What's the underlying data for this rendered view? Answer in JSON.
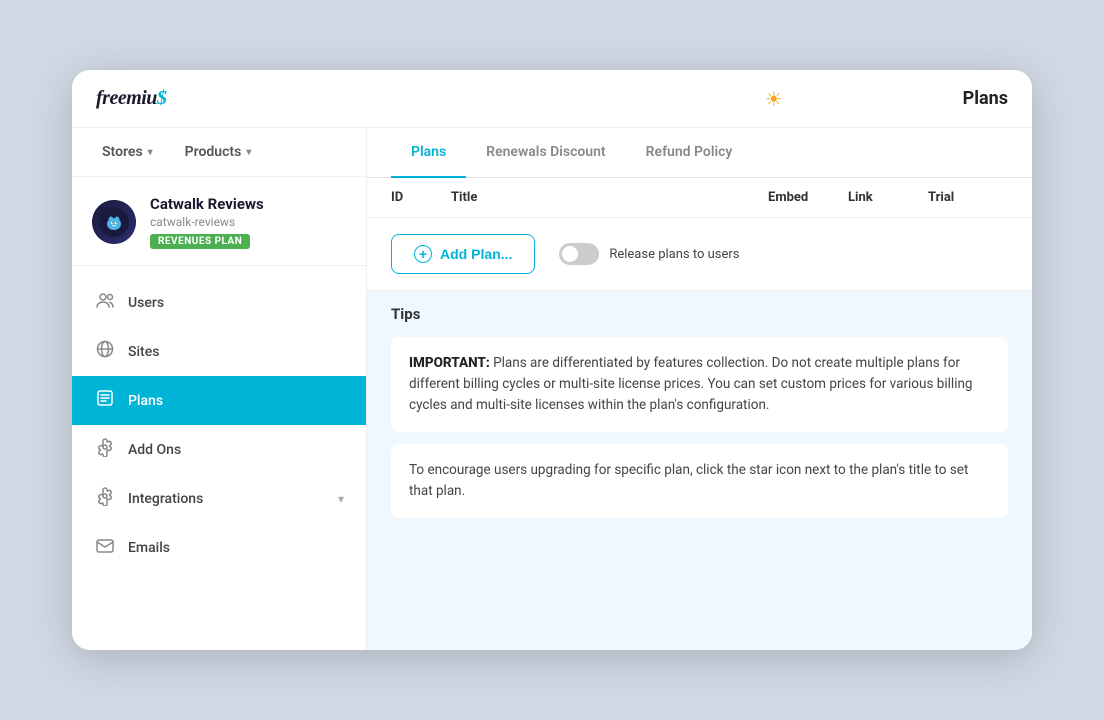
{
  "header": {
    "logo_text": "freemius",
    "logo_dollar": "$",
    "page_title": "Plans",
    "sun_icon": "☀"
  },
  "sidebar": {
    "nav": {
      "stores_label": "Stores",
      "products_label": "Products"
    },
    "product": {
      "name": "Catwalk Reviews",
      "slug": "catwalk-reviews",
      "badge": "REVENUES PLAN",
      "avatar_emoji": "🐱"
    },
    "menu_items": [
      {
        "id": "users",
        "label": "Users",
        "icon": "👥",
        "active": false
      },
      {
        "id": "sites",
        "label": "Sites",
        "icon": "🌐",
        "active": false
      },
      {
        "id": "plans",
        "label": "Plans",
        "icon": "📋",
        "active": true
      },
      {
        "id": "addons",
        "label": "Add Ons",
        "icon": "⚙",
        "active": false
      },
      {
        "id": "integrations",
        "label": "Integrations",
        "icon": "⚙",
        "active": false,
        "has_chevron": true
      },
      {
        "id": "emails",
        "label": "Emails",
        "icon": "✉",
        "active": false
      }
    ]
  },
  "content": {
    "tabs": [
      {
        "id": "plans",
        "label": "Plans",
        "active": true
      },
      {
        "id": "renewals",
        "label": "Renewals Discount",
        "active": false
      },
      {
        "id": "refund",
        "label": "Refund Policy",
        "active": false
      }
    ],
    "table_headers": {
      "id": "ID",
      "title": "Title",
      "embed": "Embed",
      "link": "Link",
      "trial": "Trial"
    },
    "add_plan_btn_label": "Add Plan...",
    "release_plans_label": "Release plans to users",
    "tips_section": {
      "title": "Tips",
      "cards": [
        {
          "text_bold": "IMPORTANT:",
          "text": " Plans are differentiated by features collection. Do not create multiple plans for different billing cycles or multi-site license prices. You can set custom prices for various billing cycles and multi-site licenses within the plan's configuration."
        },
        {
          "text": "To encourage users upgrading for specific plan, click the star icon next to the plan's title to set that plan."
        }
      ]
    }
  },
  "colors": {
    "accent": "#00b4d8",
    "active_bg": "#00b4d8",
    "badge_green": "#4caf50",
    "tips_bg": "#f0f8ff"
  }
}
